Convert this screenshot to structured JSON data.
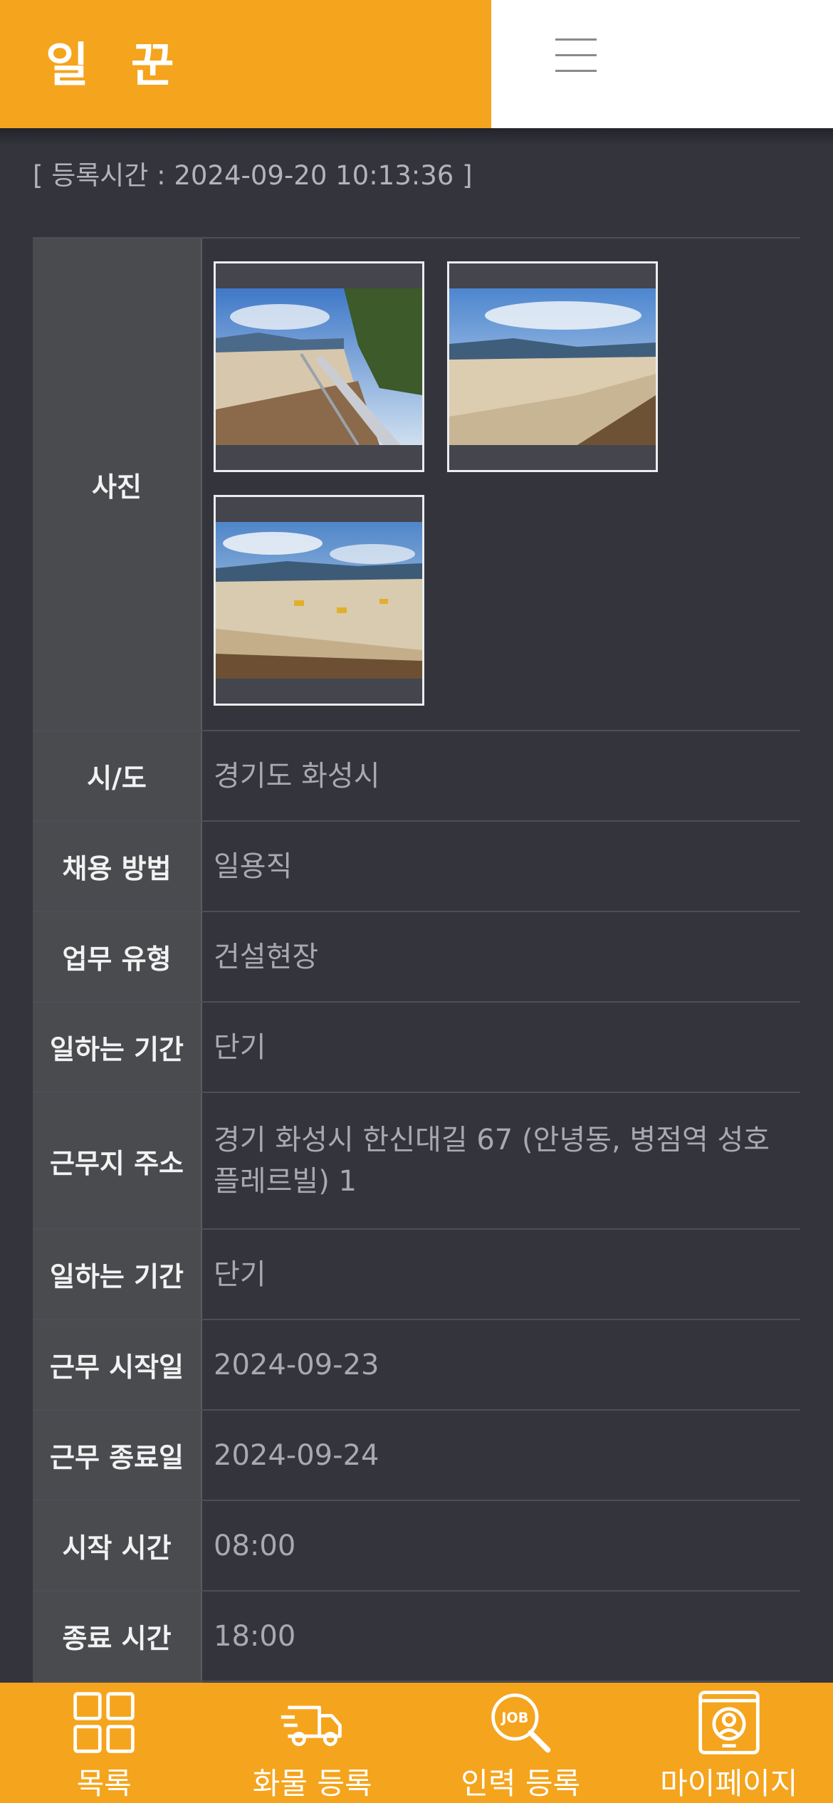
{
  "header": {
    "logo": "일 꾼"
  },
  "registration_time": "[ 등록시간 : 2024-09-20 10:13:36 ]",
  "photo_label": "사진",
  "photos": [
    {
      "icon": "construction-site-photo-1"
    },
    {
      "icon": "construction-site-photo-2"
    },
    {
      "icon": "construction-site-photo-3"
    }
  ],
  "details": [
    {
      "label": "시/도",
      "value": "경기도 화성시"
    },
    {
      "label": "채용 방법",
      "value": "일용직"
    },
    {
      "label": "업무 유형",
      "value": "건설현장"
    },
    {
      "label": "일하는 기간",
      "value": "단기"
    },
    {
      "label": "근무지 주소",
      "value": "경기 화성시 한신대길 67 (안녕동, 병점역 성호플레르빌) 1"
    },
    {
      "label": "일하는 기간",
      "value": "단기"
    },
    {
      "label": "근무 시작일",
      "value": "2024-09-23"
    },
    {
      "label": "근무 종료일",
      "value": "2024-09-24"
    },
    {
      "label": "시작 시간",
      "value": "08:00"
    },
    {
      "label": "종료 시간",
      "value": "18:00"
    },
    {
      "label": "",
      "value": ""
    }
  ],
  "nav": [
    {
      "label": "목록",
      "icon": "grid-list-icon"
    },
    {
      "label": "화물 등록",
      "icon": "truck-icon"
    },
    {
      "label": "인력 등록",
      "icon": "job-search-icon"
    },
    {
      "label": "마이페이지",
      "icon": "user-profile-icon"
    }
  ],
  "colors": {
    "accent": "#f5a41d",
    "background": "#33343c",
    "label_bg": "#4a4b4f"
  }
}
